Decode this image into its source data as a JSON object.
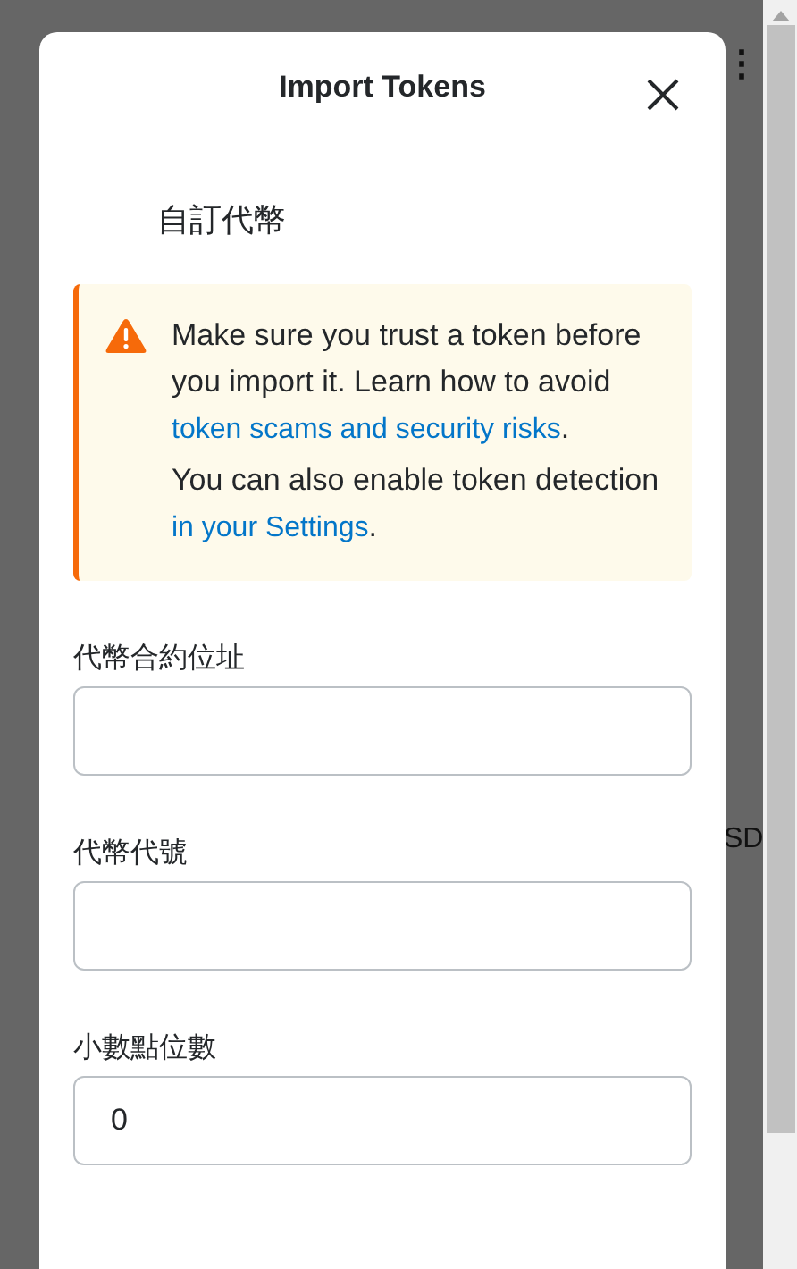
{
  "background": {
    "menu_icon": "⋮",
    "partial_text": "SD"
  },
  "modal": {
    "title": "Import Tokens",
    "tab": "自訂代幣",
    "warning": {
      "paragraphs": [
        {
          "text": "Make sure you trust a token before you import it. Learn how to avoid ",
          "link": "token scams and security risks",
          "after": "."
        },
        {
          "text": "You can also enable token detection ",
          "link": "in your Settings",
          "after": "."
        }
      ]
    },
    "fields": [
      {
        "label": "代幣合約位址"
      },
      {
        "label": "代幣代號"
      },
      {
        "label": "小數點位數",
        "value": "0"
      }
    ]
  }
}
